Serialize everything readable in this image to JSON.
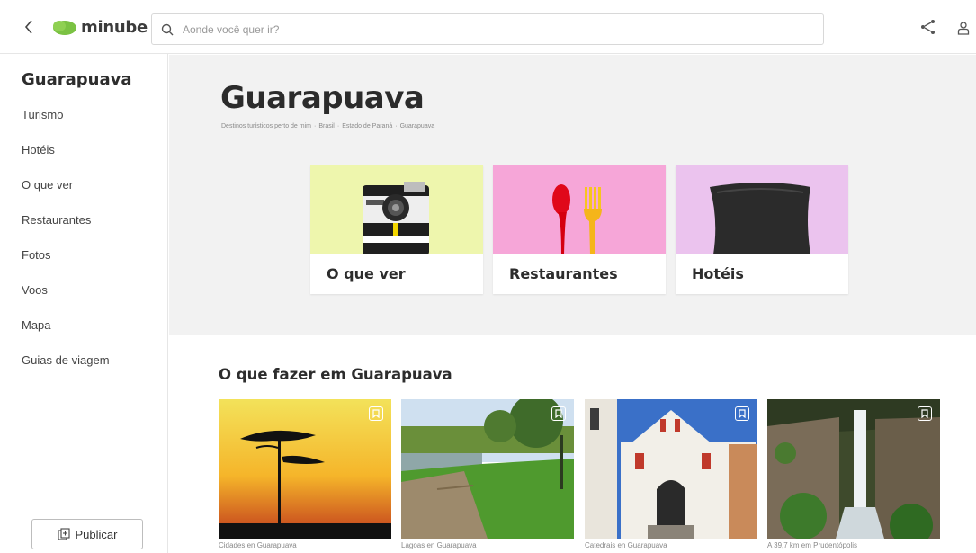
{
  "header": {
    "logo_text": "minube",
    "search_placeholder": "Aonde você quer ir?"
  },
  "sidebar": {
    "title": "Guarapuava",
    "items": [
      {
        "label": "Turismo"
      },
      {
        "label": "Hotéis"
      },
      {
        "label": "O que ver"
      },
      {
        "label": "Restaurantes"
      },
      {
        "label": "Fotos"
      },
      {
        "label": "Voos"
      },
      {
        "label": "Mapa"
      },
      {
        "label": "Guias de viagem"
      }
    ],
    "publish_label": "Publicar"
  },
  "hero": {
    "title": "Guarapuava",
    "breadcrumb": [
      {
        "label": "Destinos turísticos perto de mim"
      },
      {
        "label": "Brasil"
      },
      {
        "label": "Estado de Paraná"
      },
      {
        "label": "Guarapuava"
      }
    ],
    "breadcrumb_separator": "·"
  },
  "categories": [
    {
      "label": "O que ver",
      "bg": "#eef6ad"
    },
    {
      "label": "Restaurantes",
      "bg": "#f6a6d8"
    },
    {
      "label": "Hotéis",
      "bg": "#ebc3ee"
    }
  ],
  "section": {
    "title": "O que fazer em Guarapuava"
  },
  "photos": [
    {
      "caption": "Cidades en Guarapuava",
      "icon": "bookmark-icon"
    },
    {
      "caption": "Lagoas en Guarapuava",
      "icon": "bookmark-icon"
    },
    {
      "caption": "Catedrais en Guarapuava",
      "icon": "bookmark-icon"
    },
    {
      "caption": "A 39,7 km em Prudentópolis",
      "icon": "bookmark-icon"
    }
  ],
  "colors": {
    "brand_green": "#7bc243",
    "hero_bg": "#f2f2f2"
  }
}
